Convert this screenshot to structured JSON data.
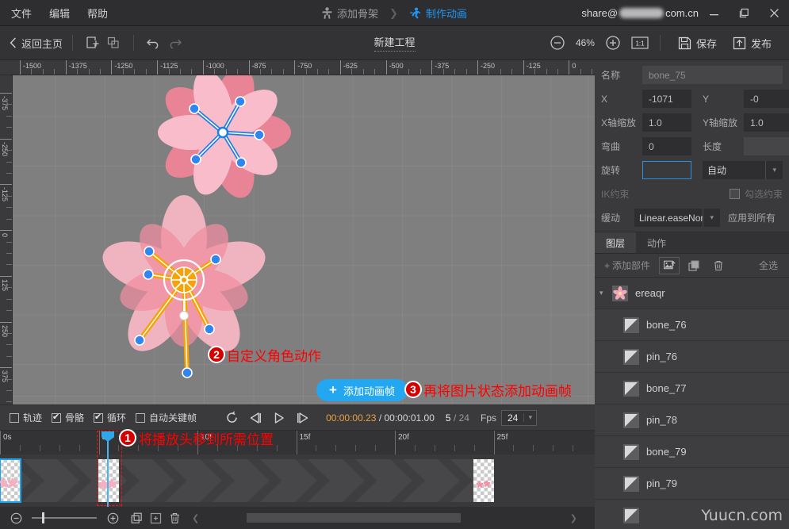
{
  "titlebar": {
    "menus": [
      {
        "label": "文件",
        "name": "menu-file"
      },
      {
        "label": "编辑",
        "name": "menu-edit"
      },
      {
        "label": "帮助",
        "name": "menu-help"
      }
    ],
    "steps": [
      {
        "label": "添加骨架",
        "icon": "skeleton-icon",
        "active": false
      },
      {
        "label": "制作动画",
        "icon": "run-icon",
        "active": true
      }
    ],
    "separator": "❯",
    "account_prefix": "share@",
    "account_suffix": "com.cn",
    "window_buttons": {
      "minimize": "—",
      "maximize": "❐",
      "close": "✕"
    },
    "accent": "#2196f3"
  },
  "toolbar": {
    "back_label": "返回主页",
    "back_icon": "chevron-left-icon",
    "new_icon": "new-file-icon",
    "duplicate_icon": "duplicate-icon",
    "undo_icon": "undo-icon",
    "redo_icon": "redo-icon",
    "project_title": "新建工程",
    "zoom_out_icon": "zoom-out-icon",
    "zoom_value": "46%",
    "zoom_in_icon": "zoom-in-icon",
    "actual_size_label": "1:1",
    "save_label": "保存",
    "save_icon": "save-icon",
    "publish_label": "发布",
    "publish_icon": "upload-icon"
  },
  "stage": {
    "ruler_h_labels": [
      "-1500",
      "-1375",
      "-1250",
      "-1125",
      "-1000",
      "-875",
      "-750",
      "-625",
      "-500",
      "-375",
      "-250",
      "-125",
      "0"
    ],
    "ruler_v_labels": [
      "-375",
      "-250",
      "-125",
      "0",
      "125",
      "250",
      "375"
    ],
    "background": "#7f7f7f"
  },
  "annotations": [
    {
      "num": "①",
      "text": "将播放头移到所需位置",
      "name": "annotation-step-1"
    },
    {
      "num": "②",
      "text": "自定义角色动作",
      "name": "annotation-step-2"
    },
    {
      "num": "③",
      "text": "再将图片状态添加动画帧",
      "name": "annotation-step-3"
    }
  ],
  "add_frame_button": {
    "label": "添加动画帧",
    "plus": "+",
    "color": "#22a7f0"
  },
  "properties": {
    "name_label": "名称",
    "name_value": "bone_75",
    "x_label": "X",
    "x_value": "-1071",
    "y_label": "Y",
    "y_value": "-0",
    "scale_x_label": "X轴缩放",
    "scale_x_value": "1.0",
    "scale_y_label": "Y轴缩放",
    "scale_y_value": "1.0",
    "bend_label": "弯曲",
    "bend_value": "0",
    "length_label": "长度",
    "length_value": "",
    "rotate_label": "旋转",
    "rotate_value": "",
    "mode_value": "自动",
    "ik_label": "IK约束",
    "ik_check_label": "勾选约束",
    "easing_label": "缓动",
    "easing_value": "Linear.easeNone",
    "apply_all_label": "应用到所有"
  },
  "panel_tabs": [
    {
      "label": "图层",
      "active": true,
      "name": "tab-layers"
    },
    {
      "label": "动作",
      "active": false,
      "name": "tab-actions"
    }
  ],
  "layer_toolbar": {
    "add_part_label": "添加部件",
    "add_part_plus": "+",
    "import_image_icon": "import-image-icon",
    "copy_icon": "copy-icon",
    "delete_icon": "trash-icon",
    "select_all_label": "全选"
  },
  "layers": [
    {
      "name": "ereaqr",
      "type": "group",
      "icon": "flower-icon",
      "caret": "▾"
    },
    {
      "name": "bone_76",
      "type": "bone",
      "icon": "bone-icon"
    },
    {
      "name": "pin_76",
      "type": "bone",
      "icon": "bone-icon"
    },
    {
      "name": "bone_77",
      "type": "bone",
      "icon": "bone-icon"
    },
    {
      "name": "pin_78",
      "type": "bone",
      "icon": "bone-icon"
    },
    {
      "name": "bone_79",
      "type": "bone",
      "icon": "bone-icon"
    },
    {
      "name": "pin_79",
      "type": "bone",
      "icon": "bone-icon"
    }
  ],
  "timeline": {
    "checkboxes": [
      {
        "label": "轨迹",
        "checked": false,
        "name": "checkbox-trajectory"
      },
      {
        "label": "骨骼",
        "checked": true,
        "name": "checkbox-bones"
      },
      {
        "label": "循环",
        "checked": true,
        "name": "checkbox-loop"
      },
      {
        "label": "自动关键帧",
        "checked": false,
        "name": "checkbox-autokey"
      }
    ],
    "transport": {
      "loop_icon": "loop-icon",
      "prev_frame_icon": "prev-frame-icon",
      "play_icon": "play-icon",
      "next_frame_icon": "next-frame-icon"
    },
    "current_time": "00:00:00.23",
    "total_time": "00:00:01.00",
    "time_separator": "/",
    "current_frame": "5",
    "total_frames": "24",
    "frame_separator": "/",
    "fps_label": "Fps",
    "fps_value": "24",
    "ruler_labels": [
      "0s",
      "5f",
      "10f",
      "15f",
      "20f",
      "25f"
    ],
    "playhead_frame": 5,
    "keyframes": [
      0,
      5,
      22
    ]
  },
  "timeline_bottom": {
    "zoom_out_icon": "zoom-out-icon",
    "zoom_in_icon": "zoom-in-icon",
    "copy_frame_icon": "copy-frame-icon",
    "add_frame_icon": "add-frame-icon",
    "delete_frame_icon": "trash-icon",
    "collapse_icon": "chevron-left-icon"
  },
  "watermark": "Yuucn.com"
}
